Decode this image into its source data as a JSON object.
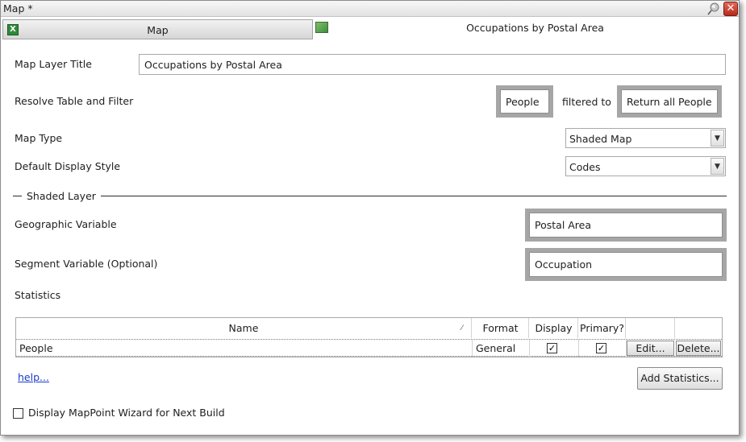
{
  "window": {
    "title": "Map *",
    "close_glyph": "✕"
  },
  "tabs": {
    "map_label": "Map",
    "layer_label": "Occupations by Postal Area",
    "map_icon_glyph": "X"
  },
  "form": {
    "map_layer_title_label": "Map Layer Title",
    "map_layer_title_value": "Occupations by Postal Area",
    "resolve_label": "Resolve Table and Filter",
    "resolve_table": "People",
    "filtered_to_label": "filtered to",
    "resolve_filter": "Return all People",
    "map_type_label": "Map Type",
    "map_type_value": "Shaded Map",
    "display_style_label": "Default Display Style",
    "display_style_value": "Codes"
  },
  "shaded_layer": {
    "section_title": "Shaded Layer",
    "geographic_label": "Geographic Variable",
    "geographic_value": "Postal Area",
    "segment_label": "Segment Variable (Optional)",
    "segment_value": "Occupation",
    "statistics_label": "Statistics"
  },
  "statistics_grid": {
    "columns": [
      "Name",
      "Format",
      "Display",
      "Primary?"
    ],
    "rows": [
      {
        "name": "People",
        "format": "General",
        "display": true,
        "primary": true,
        "edit_label": "Edit...",
        "delete_label": "Delete..."
      }
    ]
  },
  "footer": {
    "help_link": "help...",
    "add_statistics": "Add Statistics...",
    "wizard_checkbox_label": "Display MapPoint Wizard for Next Build",
    "wizard_checked": false
  },
  "icons": {
    "check_glyph": "✓",
    "dropdown_glyph": "▼",
    "sort_glyph": "⁄"
  },
  "colors": {
    "frame_grey": "#a6a6a6",
    "link_blue": "#1a3cc8",
    "close_red": "#c8392b",
    "tab_icon_green": "#2f8b38"
  }
}
